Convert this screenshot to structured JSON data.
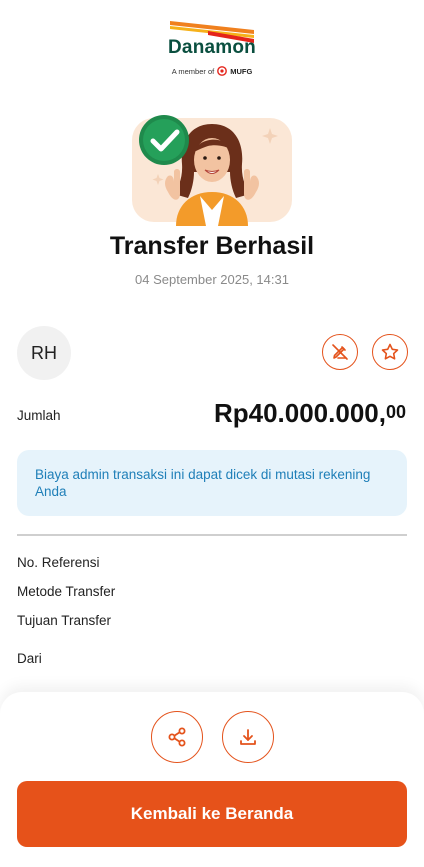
{
  "brand": {
    "name": "Danamon",
    "tagline": "A member of",
    "partner": "MUFG",
    "colors": {
      "stripe_orange": "#f0801e",
      "stripe_gold": "#f6b11a",
      "stripe_red": "#e4241b",
      "wordmark": "#0a4f3f"
    }
  },
  "status": {
    "illustration": "success-woman-thumbs-up",
    "title": "Transfer Berhasil",
    "datetime": "04 September 2025, 14:31"
  },
  "recipient": {
    "initials": "RH",
    "actions": [
      {
        "icon": "no-edit-icon"
      },
      {
        "icon": "star-icon"
      }
    ]
  },
  "amount": {
    "label": "Jumlah",
    "value": "Rp40.000.000,",
    "decimals": "00"
  },
  "info": {
    "text": "Biaya admin transaksi ini dapat dicek di mutasi rekening Anda"
  },
  "details": {
    "reference_label": "No. Referensi",
    "method_label": "Metode Transfer",
    "destination_label": "Tujuan Transfer",
    "source_label": "Dari"
  },
  "footer": {
    "share_icon": "share-icon",
    "download_icon": "download-icon",
    "primary_label": "Kembali ke Beranda"
  },
  "theme": {
    "accent": "#e6521a",
    "info_bg": "#e6f3fb",
    "info_text": "#1f7fb8"
  }
}
